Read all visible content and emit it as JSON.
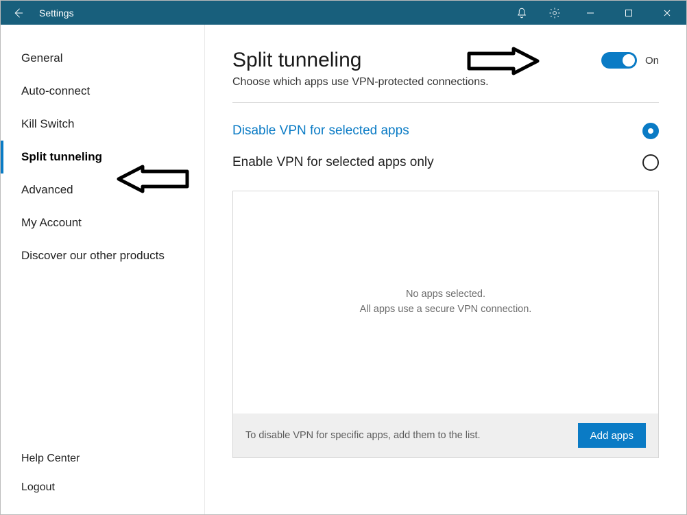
{
  "titlebar": {
    "title": "Settings"
  },
  "sidebar": {
    "items": [
      {
        "label": "General"
      },
      {
        "label": "Auto-connect"
      },
      {
        "label": "Kill Switch"
      },
      {
        "label": "Split tunneling"
      },
      {
        "label": "Advanced"
      },
      {
        "label": "My Account"
      },
      {
        "label": "Discover our other products"
      }
    ],
    "bottom": [
      {
        "label": "Help Center"
      },
      {
        "label": "Logout"
      }
    ]
  },
  "main": {
    "title": "Split tunneling",
    "subtitle": "Choose which apps use VPN-protected connections.",
    "toggle_label": "On",
    "options": {
      "disable": "Disable VPN for selected apps",
      "enable": "Enable VPN for selected apps only"
    },
    "empty": {
      "line1": "No apps selected.",
      "line2": "All apps use a secure VPN connection."
    },
    "footer_hint": "To disable VPN for specific apps, add them to the list.",
    "add_button": "Add apps"
  }
}
